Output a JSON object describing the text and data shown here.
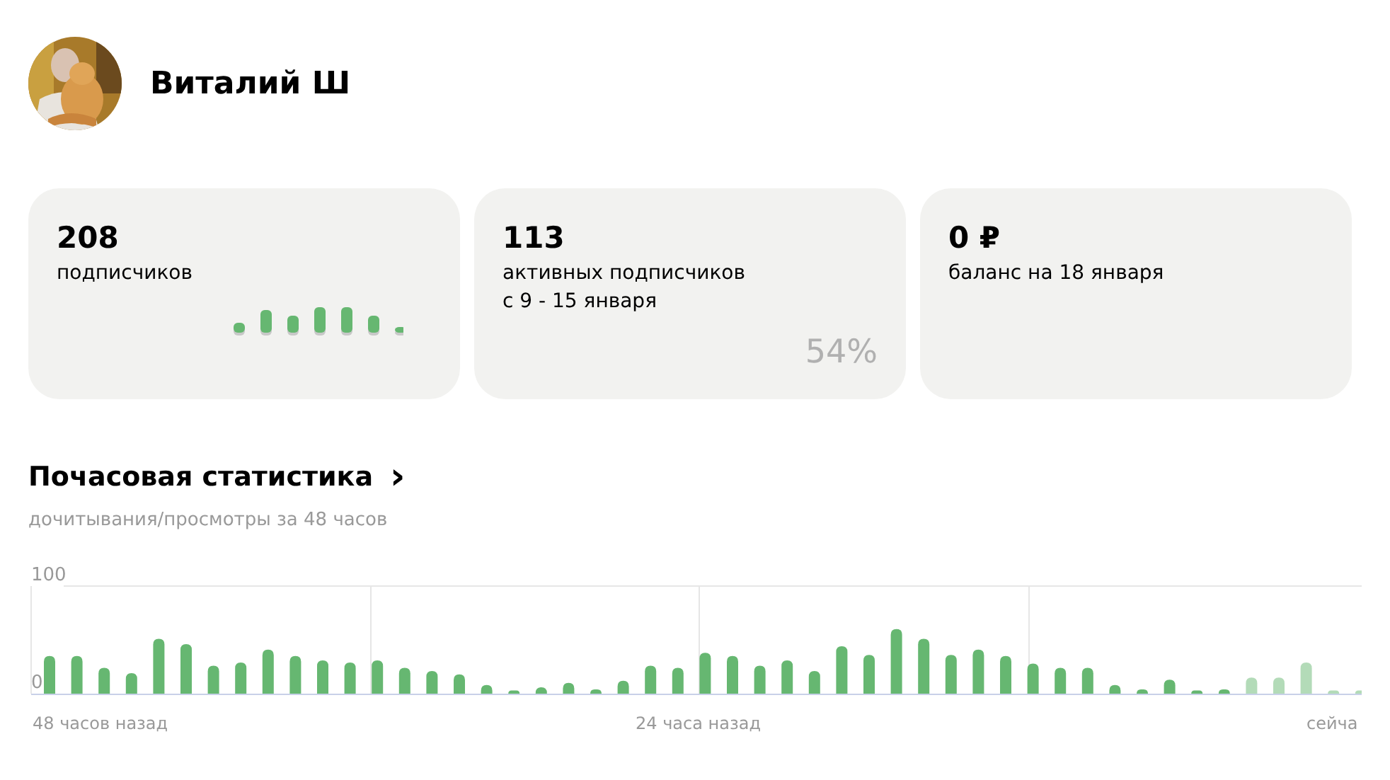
{
  "profile": {
    "name": "Виталий Ш"
  },
  "cards": [
    {
      "kind": "sparkline",
      "value": "208",
      "label": "подписчиков"
    },
    {
      "kind": "percent",
      "value": "113",
      "label": "активных подписчиков",
      "sublabel": "с 9 - 15 января",
      "percent": "54%"
    },
    {
      "kind": "plain",
      "value": "0 ₽",
      "label": "баланс на 18 января"
    }
  ],
  "stats": {
    "title": "Почасовая статистика",
    "chevron": "›",
    "subtitle": "дочитывания/просмотры за 48 часов",
    "x_labels": [
      "48 часов назад",
      "24 часа назад",
      "сейча"
    ],
    "chart_data": {
      "type": "bar",
      "ylim": [
        0,
        100
      ],
      "yticks": [
        100,
        0
      ],
      "series": [
        {
          "color": "#66b771",
          "values": [
            35,
            35,
            24,
            19,
            51,
            46,
            26,
            29,
            41,
            35,
            31,
            29,
            31,
            24,
            21,
            18,
            8,
            3,
            6,
            10,
            4,
            12,
            26,
            24,
            38,
            35,
            26,
            31,
            21,
            44,
            36,
            60,
            51,
            36,
            41,
            35,
            28,
            24,
            24,
            8,
            4,
            13,
            3,
            4,
            null,
            null,
            null,
            null,
            null
          ]
        },
        {
          "color": "#b3dbb8",
          "values": [
            null,
            null,
            null,
            null,
            null,
            null,
            null,
            null,
            null,
            null,
            null,
            null,
            null,
            null,
            null,
            null,
            null,
            null,
            null,
            null,
            null,
            null,
            null,
            null,
            null,
            null,
            null,
            null,
            null,
            null,
            null,
            null,
            null,
            null,
            null,
            null,
            null,
            null,
            null,
            null,
            null,
            null,
            null,
            null,
            15,
            15,
            29,
            3,
            3
          ]
        }
      ]
    }
  }
}
